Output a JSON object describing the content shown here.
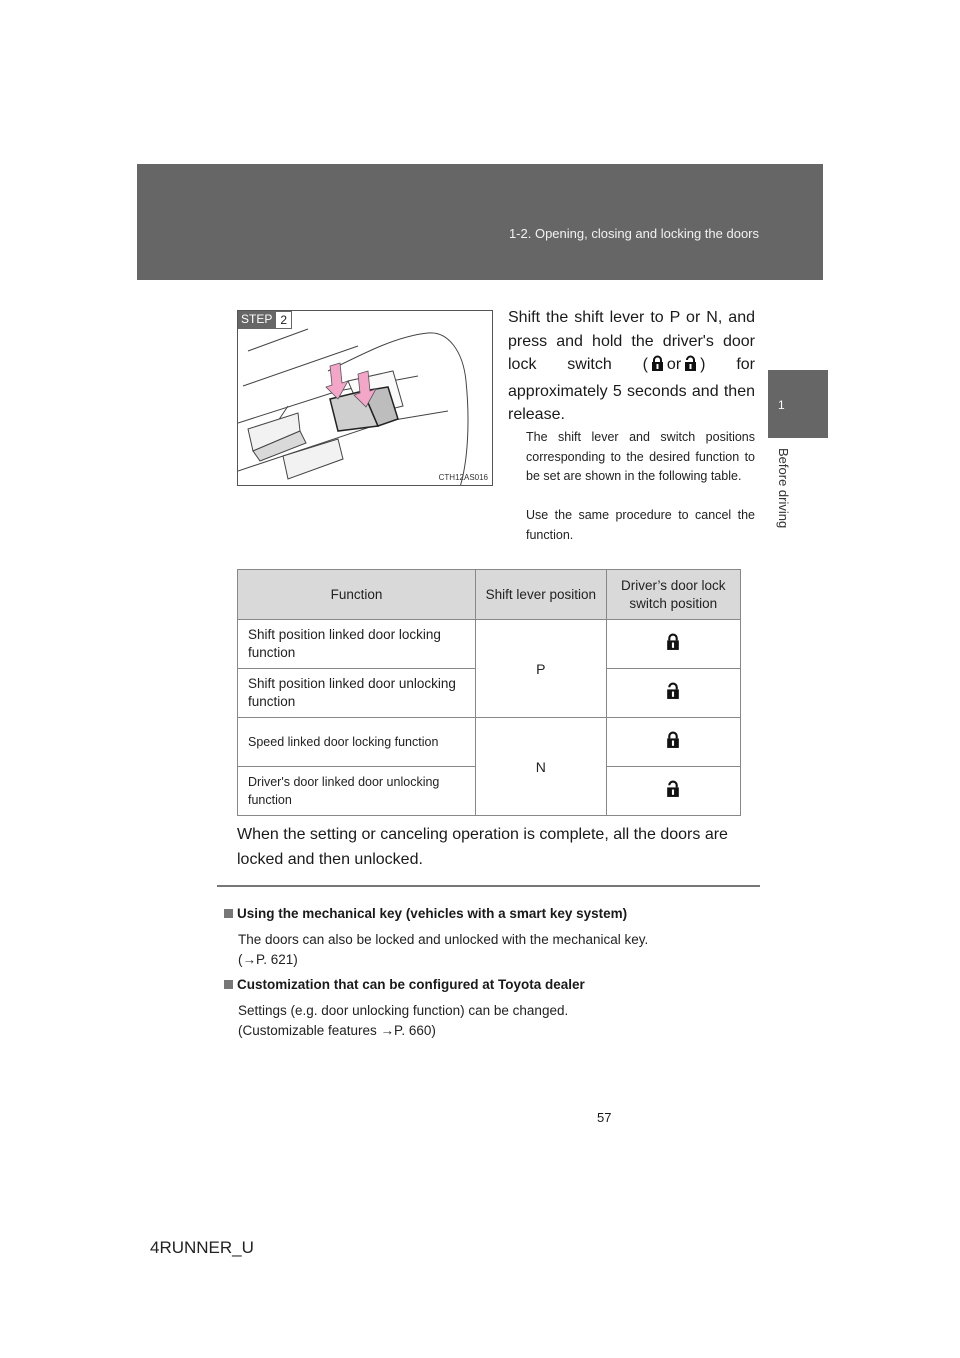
{
  "header": {
    "section_title": "1-2. Opening, closing and locking the doors"
  },
  "side_tab": {
    "chapter_number": "1",
    "chapter_label": "Before driving"
  },
  "figure": {
    "step_label": "STEP",
    "step_number": "2",
    "figure_code": "CTH12AS016",
    "accent_color": "#f4a6c8"
  },
  "step": {
    "main_text_before": "Shift the shift lever to P or N, and press and hold the driver's door lock switch (",
    "main_text_or": "or",
    "main_text_after": ") for approximately 5 seconds and then release.",
    "sub_paragraph_1": "The shift lever and switch positions corresponding to the desired function to be set are shown in the following table.",
    "sub_paragraph_2": "Use the same procedure to cancel the function."
  },
  "table": {
    "headers": [
      "Function",
      "Shift lever position",
      "Driver’s door lock switch position"
    ],
    "rows": [
      {
        "function": "Shift position linked door locking function",
        "switch_icon": "lock-icon"
      },
      {
        "function": "Shift position linked door unlocking function",
        "switch_icon": "unlock-icon"
      },
      {
        "function": "Speed linked door locking function",
        "switch_icon": "lock-icon"
      },
      {
        "function": "Driver's door linked door unlocking function",
        "switch_icon": "unlock-icon"
      }
    ],
    "shift_positions": [
      "P",
      "N"
    ]
  },
  "completion_note": "When the setting or canceling operation is complete, all the doors are locked and then unlocked.",
  "notes": [
    {
      "heading": "Using the mechanical key (vehicles with a smart key system)",
      "body_line_1": "The doors can also be locked and unlocked with the mechanical key.",
      "body_line_2": "(→P. 621)"
    },
    {
      "heading": "Customization that can be configured at Toyota dealer",
      "body_line_1": "Settings (e.g. door unlocking function) can be changed.",
      "body_line_2": "(Customizable features →P. 660)"
    }
  ],
  "footer": {
    "page_number": "57",
    "model_code": "4RUNNER_U"
  }
}
